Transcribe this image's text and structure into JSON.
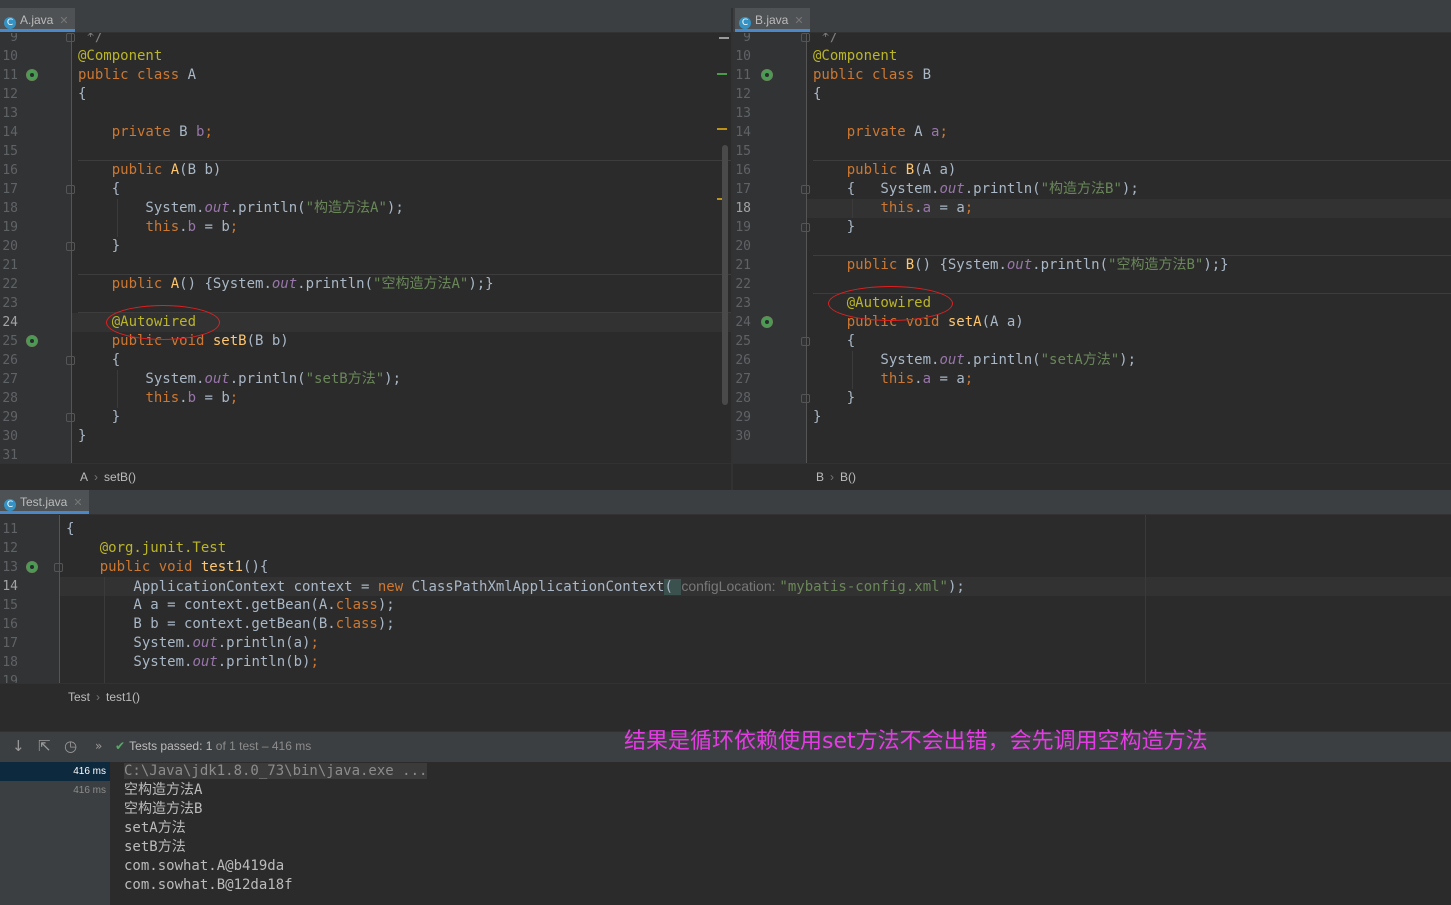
{
  "tabs": {
    "left": {
      "label": "A.java",
      "icon": "class-icon"
    },
    "right": {
      "label": "B.java",
      "icon": "class-icon"
    },
    "bottom": {
      "label": "Test.java",
      "icon": "class-icon"
    }
  },
  "editor_a": {
    "line_numbers": [
      "9",
      "10",
      "11",
      "12",
      "13",
      "14",
      "15",
      "16",
      "17",
      "18",
      "19",
      "20",
      "21",
      "22",
      "23",
      "24",
      "25",
      "26",
      "27",
      "28",
      "29",
      "30",
      "31"
    ],
    "current_line": "24",
    "lines": [
      [
        {
          "t": " */",
          "c": "cmt"
        }
      ],
      [
        {
          "t": "@Component",
          "c": "ann"
        }
      ],
      [
        {
          "t": "public class ",
          "c": "kw"
        },
        {
          "t": "A",
          "c": ""
        }
      ],
      [
        {
          "t": "{",
          "c": ""
        }
      ],
      [],
      [
        {
          "t": "    private ",
          "c": "kw"
        },
        {
          "t": "B ",
          "c": ""
        },
        {
          "t": "b",
          "c": "fld"
        },
        {
          "t": ";",
          "c": "kw"
        }
      ],
      [],
      [
        {
          "t": "    public ",
          "c": "kw"
        },
        {
          "t": "A",
          "c": "fn"
        },
        {
          "t": "(B b)",
          "c": ""
        }
      ],
      [
        {
          "t": "    {",
          "c": ""
        }
      ],
      [
        {
          "t": "        System.",
          "c": ""
        },
        {
          "t": "out",
          "c": "st"
        },
        {
          "t": ".println(",
          "c": ""
        },
        {
          "t": "\"构造方法A\"",
          "c": "str"
        },
        {
          "t": ");",
          "c": ""
        }
      ],
      [
        {
          "t": "        ",
          "c": ""
        },
        {
          "t": "this",
          "c": "kw"
        },
        {
          "t": ".",
          "c": ""
        },
        {
          "t": "b",
          "c": "fld"
        },
        {
          "t": " = b",
          "c": ""
        },
        {
          "t": ";",
          "c": "kw"
        }
      ],
      [
        {
          "t": "    }",
          "c": ""
        }
      ],
      [],
      [
        {
          "t": "    public ",
          "c": "kw"
        },
        {
          "t": "A",
          "c": "fn"
        },
        {
          "t": "() {System.",
          "c": ""
        },
        {
          "t": "out",
          "c": "st"
        },
        {
          "t": ".println(",
          "c": ""
        },
        {
          "t": "\"空构造方法A\"",
          "c": "str"
        },
        {
          "t": ");}",
          "c": ""
        }
      ],
      [],
      [
        {
          "t": "    @Autowired",
          "c": "ann"
        }
      ],
      [
        {
          "t": "    public void ",
          "c": "kw"
        },
        {
          "t": "setB",
          "c": "fn"
        },
        {
          "t": "(B b)",
          "c": ""
        }
      ],
      [
        {
          "t": "    {",
          "c": ""
        }
      ],
      [
        {
          "t": "        System.",
          "c": ""
        },
        {
          "t": "out",
          "c": "st"
        },
        {
          "t": ".println(",
          "c": ""
        },
        {
          "t": "\"setB方法\"",
          "c": "str"
        },
        {
          "t": ");",
          "c": ""
        }
      ],
      [
        {
          "t": "        ",
          "c": ""
        },
        {
          "t": "this",
          "c": "kw"
        },
        {
          "t": ".",
          "c": ""
        },
        {
          "t": "b",
          "c": "fld"
        },
        {
          "t": " = b",
          "c": ""
        },
        {
          "t": ";",
          "c": "kw"
        }
      ],
      [
        {
          "t": "    }",
          "c": ""
        }
      ],
      [
        {
          "t": "}",
          "c": ""
        }
      ],
      []
    ],
    "breadcrumb": [
      "A",
      "setB()"
    ]
  },
  "editor_b": {
    "line_numbers": [
      "9",
      "10",
      "11",
      "12",
      "13",
      "14",
      "15",
      "16",
      "17",
      "18",
      "19",
      "20",
      "21",
      "22",
      "23",
      "24",
      "25",
      "26",
      "27",
      "28",
      "29",
      "30"
    ],
    "current_line": "18",
    "lines": [
      [
        {
          "t": " */",
          "c": "cmt"
        }
      ],
      [
        {
          "t": "@Component",
          "c": "ann"
        }
      ],
      [
        {
          "t": "public class ",
          "c": "kw"
        },
        {
          "t": "B",
          "c": ""
        }
      ],
      [
        {
          "t": "{",
          "c": ""
        }
      ],
      [],
      [
        {
          "t": "    private ",
          "c": "kw"
        },
        {
          "t": "A ",
          "c": ""
        },
        {
          "t": "a",
          "c": "fld"
        },
        {
          "t": ";",
          "c": "kw"
        }
      ],
      [],
      [
        {
          "t": "    public ",
          "c": "kw"
        },
        {
          "t": "B",
          "c": "fn"
        },
        {
          "t": "(A a)",
          "c": ""
        }
      ],
      [
        {
          "t": "    {   System.",
          "c": ""
        },
        {
          "t": "out",
          "c": "st"
        },
        {
          "t": ".println(",
          "c": ""
        },
        {
          "t": "\"构造方法B\"",
          "c": "str"
        },
        {
          "t": ");",
          "c": ""
        }
      ],
      [
        {
          "t": "        ",
          "c": ""
        },
        {
          "t": "this",
          "c": "kw"
        },
        {
          "t": ".",
          "c": ""
        },
        {
          "t": "a",
          "c": "fld"
        },
        {
          "t": " = a",
          "c": ""
        },
        {
          "t": ";",
          "c": "kw"
        }
      ],
      [
        {
          "t": "    }",
          "c": ""
        }
      ],
      [],
      [
        {
          "t": "    public ",
          "c": "kw"
        },
        {
          "t": "B",
          "c": "fn"
        },
        {
          "t": "() {System.",
          "c": ""
        },
        {
          "t": "out",
          "c": "st"
        },
        {
          "t": ".println(",
          "c": ""
        },
        {
          "t": "\"空构造方法B\"",
          "c": "str"
        },
        {
          "t": ");}",
          "c": ""
        }
      ],
      [],
      [
        {
          "t": "    @Autowired",
          "c": "ann"
        }
      ],
      [
        {
          "t": "    public void ",
          "c": "kw"
        },
        {
          "t": "setA",
          "c": "fn"
        },
        {
          "t": "(A a)",
          "c": ""
        }
      ],
      [
        {
          "t": "    {",
          "c": ""
        }
      ],
      [
        {
          "t": "        System.",
          "c": ""
        },
        {
          "t": "out",
          "c": "st"
        },
        {
          "t": ".println(",
          "c": ""
        },
        {
          "t": "\"setA方法\"",
          "c": "str"
        },
        {
          "t": ");",
          "c": ""
        }
      ],
      [
        {
          "t": "        ",
          "c": ""
        },
        {
          "t": "this",
          "c": "kw"
        },
        {
          "t": ".",
          "c": ""
        },
        {
          "t": "a",
          "c": "fld"
        },
        {
          "t": " = a",
          "c": ""
        },
        {
          "t": ";",
          "c": "kw"
        }
      ],
      [
        {
          "t": "    }",
          "c": ""
        }
      ],
      [
        {
          "t": "}",
          "c": ""
        }
      ],
      []
    ],
    "breadcrumb": [
      "B",
      "B()"
    ]
  },
  "editor_test": {
    "line_numbers": [
      "11",
      "12",
      "13",
      "14",
      "15",
      "16",
      "17",
      "18",
      "19"
    ],
    "current_line": "14",
    "lines": [
      [
        {
          "t": "{",
          "c": ""
        }
      ],
      [
        {
          "t": "    @org.junit.Test",
          "c": "ann"
        }
      ],
      [
        {
          "t": "    public void ",
          "c": "kw"
        },
        {
          "t": "test1",
          "c": "fn"
        },
        {
          "t": "(){",
          "c": ""
        }
      ],
      [
        {
          "t": "        ApplicationContext context = ",
          "c": ""
        },
        {
          "t": "new ",
          "c": "kw"
        },
        {
          "t": "ClassPathXmlApplicationContext",
          "c": ""
        },
        {
          "t": "( ",
          "c": "paren"
        },
        {
          "t": "configLocation: ",
          "c": "hint"
        },
        {
          "t": "\"mybatis-config.xml\"",
          "c": "str"
        },
        {
          "t": ");",
          "c": ""
        }
      ],
      [
        {
          "t": "        A a = context.getBean(A.",
          "c": ""
        },
        {
          "t": "class",
          "c": "kw"
        },
        {
          "t": ");",
          "c": ""
        }
      ],
      [
        {
          "t": "        B b = context.getBean(B.",
          "c": ""
        },
        {
          "t": "class",
          "c": "kw"
        },
        {
          "t": ");",
          "c": ""
        }
      ],
      [
        {
          "t": "        System.",
          "c": ""
        },
        {
          "t": "out",
          "c": "st"
        },
        {
          "t": ".println(a)",
          "c": ""
        },
        {
          "t": ";",
          "c": "kw"
        }
      ],
      [
        {
          "t": "        System.",
          "c": ""
        },
        {
          "t": "out",
          "c": "st"
        },
        {
          "t": ".println(b)",
          "c": ""
        },
        {
          "t": ";",
          "c": "kw"
        }
      ],
      []
    ],
    "breadcrumb": [
      "Test",
      "test1()"
    ]
  },
  "run_panel": {
    "status_prefix": "Tests passed: ",
    "status_count": "1",
    "status_mid": " of 1 test",
    "status_time": " – 416 ms",
    "annotation_note": "结果是循环依赖使用set方法不会出错，会先调用空构造方法",
    "timings": [
      "416 ms",
      "416 ms"
    ],
    "console": [
      "C:\\Java\\jdk1.8.0_73\\bin\\java.exe ...",
      "空构造方法A",
      "空构造方法B",
      "setA方法",
      "setB方法",
      "com.sowhat.A@b419da",
      "com.sowhat.B@12da18f"
    ]
  },
  "colors": {
    "keyword": "#cc7832",
    "annotation": "#bbb529",
    "string": "#6a8759",
    "field": "#9876aa",
    "method": "#ffc66d",
    "highlight_ellipse": "#e02020",
    "note": "#e23ce2",
    "passed": "#59a869"
  }
}
